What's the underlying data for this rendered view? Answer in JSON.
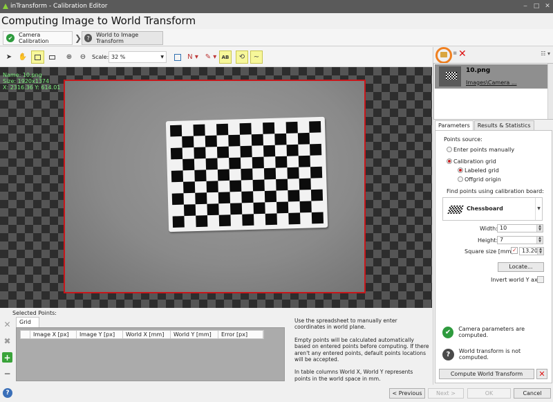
{
  "window": {
    "title": "inTransform - Calibration Editor",
    "minimize": "‒",
    "maximize": "□",
    "close": "✕"
  },
  "page_title": "Computing Image to World Transform",
  "wizard": {
    "steps": [
      {
        "label": "Camera Calibration",
        "icon": "check-circle-icon",
        "color": "#2e9b3e"
      },
      {
        "label": "World to Image Transform",
        "icon": "question-circle-icon",
        "color": "#555555"
      }
    ]
  },
  "toolbar": {
    "scale_label": "Scale:",
    "scale_value": "32 %",
    "ab_label": "AB"
  },
  "viewer": {
    "overlay": {
      "name": "Name: 10.png",
      "size": "Size: 1920x1374",
      "coords": "X: 2316.36 Y: 614.01"
    },
    "frame_color": "#c8161a",
    "board": {
      "columns": 13,
      "rows": 9
    }
  },
  "bottom": {
    "selected_points_label": "Selected Points:",
    "grid_tab": "Grid 1.1",
    "columns": [
      "Image X [px]",
      "Image Y [px]",
      "World X [mm]",
      "World Y [mm]",
      "Error [px]"
    ],
    "help": [
      "Use the spreadsheet to manually enter coordinates in world plane.",
      "Empty points will be calculated automatically based on entered points before computing. If there aren't any entered points, default points locations will be accepted.",
      "In table columns World X, World Y represents points in the world space in mm."
    ]
  },
  "images": [
    {
      "name": "10.png",
      "path": "Images\\Camera ..."
    }
  ],
  "tabs": [
    "Parameters",
    "Results & Statistics"
  ],
  "params": {
    "points_source_label": "Points source:",
    "enter_manually": "Enter points manually",
    "calibration_grid": "Calibration grid",
    "labeled_grid": "Labeled grid",
    "offgrid_origin": "Offgrid origin",
    "find_points_label": "Find points using calibration board:",
    "board_type": "Chessboard",
    "width_label": "Width:",
    "width_value": "10",
    "height_label": "Height:",
    "height_value": "7",
    "square_label": "Square size [mm]:",
    "square_value": "13.20",
    "locate_button": "Locate...",
    "invert_label": "Invert world Y axis"
  },
  "status": {
    "camera": "Camera parameters are computed.",
    "world": "World transform is not computed.",
    "ok_color": "#2e9b3e",
    "pending_color": "#4a4a4a"
  },
  "compute_button": "Compute World Transform",
  "nav": {
    "previous": "< Previous",
    "next": "Next >",
    "ok": "OK",
    "cancel": "Cancel"
  }
}
